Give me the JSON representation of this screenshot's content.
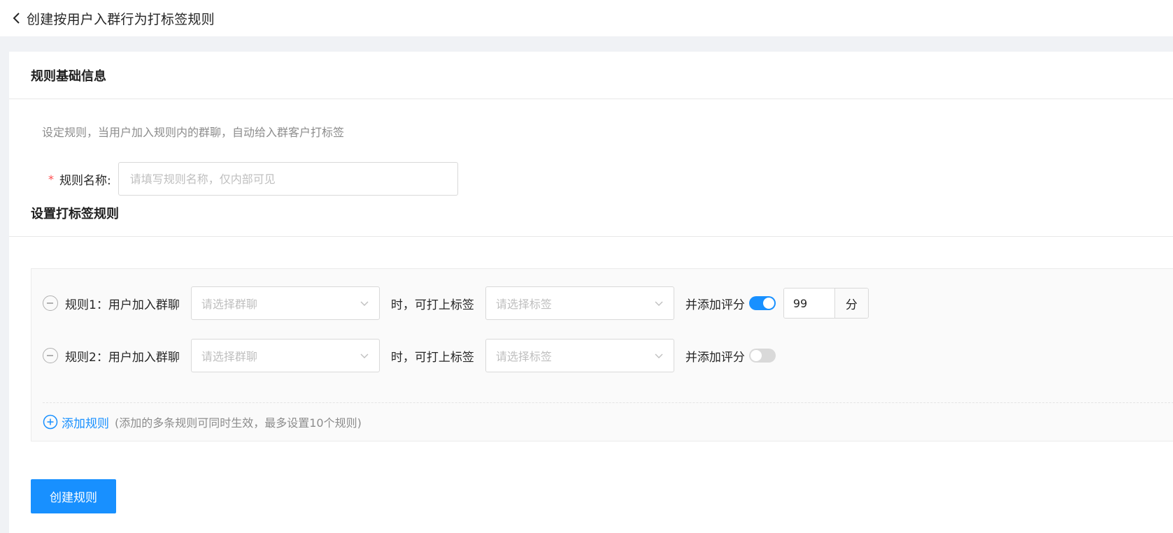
{
  "header": {
    "title": "创建按用户入群行为打标签规则",
    "back_icon": "chevron-left-icon"
  },
  "basic_section": {
    "title": "规则基础信息",
    "hint": "设定规则，当用户加入规则内的群聊，自动给入群客户打标签",
    "name_field": {
      "required_mark": "*",
      "label": "规则名称:",
      "value": "",
      "placeholder": "请填写规则名称，仅内部可见"
    }
  },
  "rules_section": {
    "title": "设置打标签规则",
    "rules": [
      {
        "label": "规则1：用户加入群聊",
        "group_select_placeholder": "请选择群聊",
        "middle_text": "时，可打上标签",
        "tag_select_placeholder": "请选择标签",
        "score_label": "并添加评分",
        "score_enabled": true,
        "score_value": "99",
        "score_unit": "分"
      },
      {
        "label": "规则2：用户加入群聊",
        "group_select_placeholder": "请选择群聊",
        "middle_text": "时，可打上标签",
        "tag_select_placeholder": "请选择标签",
        "score_label": "并添加评分",
        "score_enabled": false
      }
    ],
    "add_rule_label": "添加规则",
    "add_rule_hint": "(添加的多条规则可同时生效，最多设置10个规则)"
  },
  "submit_label": "创建规则",
  "colors": {
    "primary": "#1890ff",
    "required": "#ff4d4f",
    "page_background": "#f0f2f5"
  }
}
